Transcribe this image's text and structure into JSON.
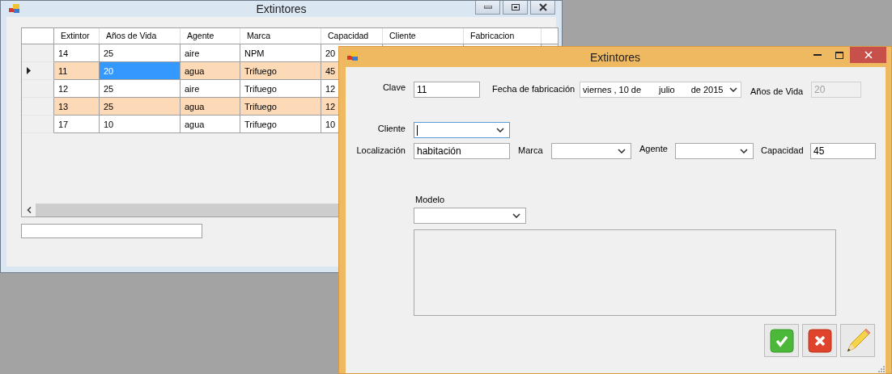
{
  "background_window": {
    "title": "Extintores",
    "grid": {
      "columns": [
        "Extintor",
        "Años de Vida",
        "Agente",
        "Marca",
        "Capacidad",
        "Cliente",
        "Fabricacion"
      ],
      "rows": [
        {
          "selected": false,
          "cells": [
            {
              "text": "14",
              "selected": false
            },
            {
              "text": "25",
              "selected": false
            },
            {
              "text": "aire",
              "selected": false
            },
            {
              "text": "NPM",
              "selected": false
            },
            {
              "text": "20",
              "selected": false
            }
          ]
        },
        {
          "selected": true,
          "cells": [
            {
              "text": "11",
              "selected": false
            },
            {
              "text": "20",
              "selected": true
            },
            {
              "text": "agua",
              "selected": false
            },
            {
              "text": "Trifuego",
              "selected": false
            },
            {
              "text": "45",
              "selected": false
            }
          ]
        },
        {
          "selected": false,
          "cells": [
            {
              "text": "12",
              "selected": false
            },
            {
              "text": "25",
              "selected": false
            },
            {
              "text": "aire",
              "selected": false
            },
            {
              "text": "Trifuego",
              "selected": false
            },
            {
              "text": "12",
              "selected": false
            }
          ]
        },
        {
          "selected": false,
          "cells": [
            {
              "text": "13",
              "selected": false
            },
            {
              "text": "25",
              "selected": false
            },
            {
              "text": "agua",
              "selected": false
            },
            {
              "text": "Trifuego",
              "selected": false
            },
            {
              "text": "12",
              "selected": false
            }
          ]
        },
        {
          "selected": false,
          "cells": [
            {
              "text": "17",
              "selected": false
            },
            {
              "text": "10",
              "selected": false
            },
            {
              "text": "agua",
              "selected": false
            },
            {
              "text": "Trifuego",
              "selected": false
            },
            {
              "text": "10",
              "selected": false
            }
          ]
        }
      ]
    }
  },
  "form_window": {
    "title": "Extintores",
    "clave": {
      "label": "Clave",
      "value": "11"
    },
    "fecha": {
      "label": "Fecha de fabricación",
      "parts": [
        "viernes",
        ", 10 de",
        "julio",
        "de 2015"
      ]
    },
    "anos_vida": {
      "label": "Años de Vida",
      "value": "20",
      "disabled": true
    },
    "cliente": {
      "label": "Cliente",
      "focused": true
    },
    "localizacion": {
      "label": "Localización",
      "value": "habitación"
    },
    "marca": {
      "label": "Marca",
      "focused": false
    },
    "agente": {
      "label": "Agente",
      "focused": false
    },
    "capacidad": {
      "label": "Capacidad",
      "value": "45"
    },
    "modelo": {
      "label": "Modelo",
      "focused": false
    },
    "buttons": [
      {
        "kind": "accept"
      },
      {
        "kind": "cancel"
      },
      {
        "kind": "edit"
      }
    ]
  }
}
